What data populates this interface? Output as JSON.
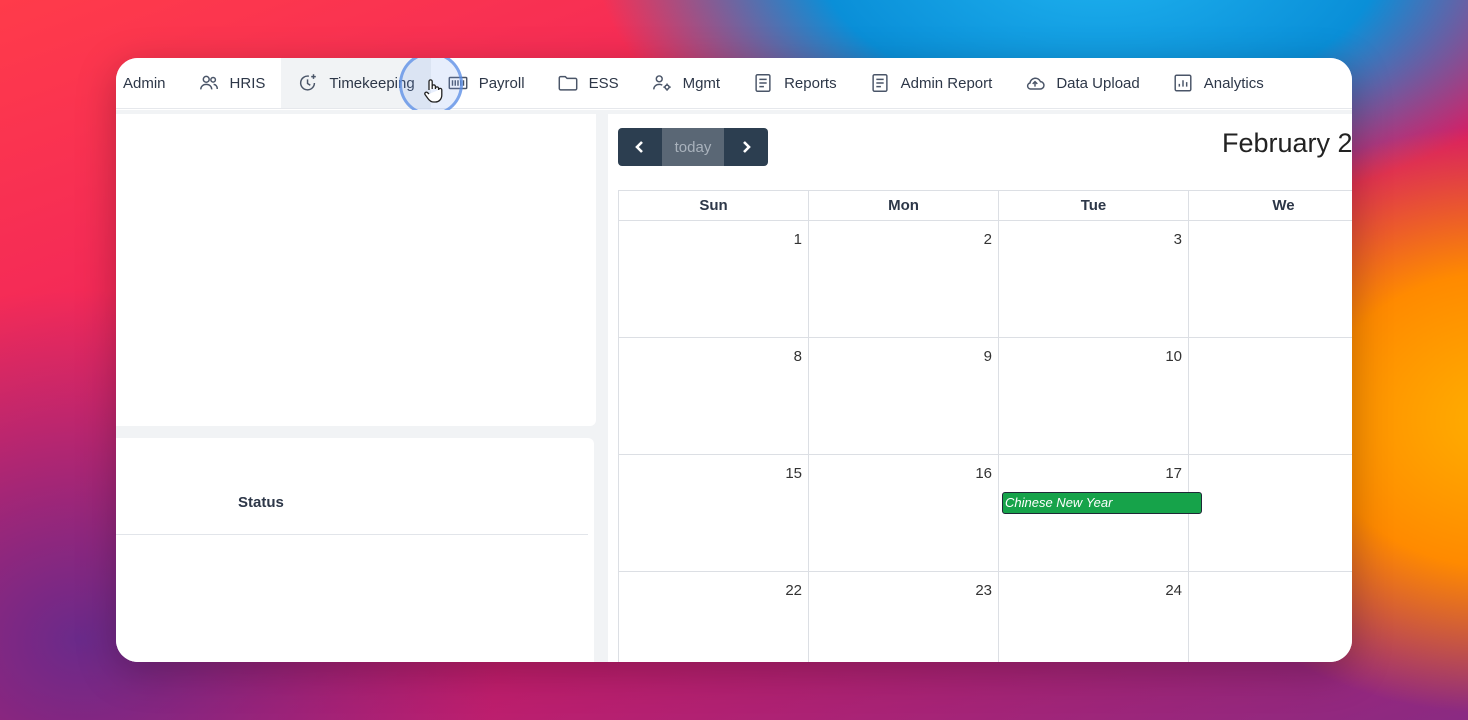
{
  "nav": {
    "items": [
      {
        "label": "Admin",
        "icon": "none"
      },
      {
        "label": "HRIS",
        "icon": "users-icon"
      },
      {
        "label": "Timekeeping",
        "icon": "clock-plus-icon"
      },
      {
        "label": "Payroll",
        "icon": "payroll-icon"
      },
      {
        "label": "ESS",
        "icon": "folder-icon"
      },
      {
        "label": "Mgmt",
        "icon": "user-gear-icon"
      },
      {
        "label": "Reports",
        "icon": "document-icon"
      },
      {
        "label": "Admin Report",
        "icon": "document-icon"
      },
      {
        "label": "Data Upload",
        "icon": "cloud-upload-icon"
      },
      {
        "label": "Analytics",
        "icon": "chart-icon"
      }
    ],
    "active": "Timekeeping"
  },
  "left_panel": {
    "status_header": "Status"
  },
  "calendar": {
    "today_label": "today",
    "month_title": "February 2",
    "weekdays": [
      "Sun",
      "Mon",
      "Tue",
      "We"
    ],
    "weeks": [
      [
        "1",
        "2",
        "3",
        ""
      ],
      [
        "8",
        "9",
        "10",
        ""
      ],
      [
        "15",
        "16",
        "17",
        ""
      ],
      [
        "22",
        "23",
        "24",
        ""
      ]
    ],
    "event": {
      "title": "Chinese New Year",
      "color": "#16a34a"
    }
  },
  "colors": {
    "nav_button_dark": "#2c3e50",
    "today_button": "#5a6775"
  }
}
